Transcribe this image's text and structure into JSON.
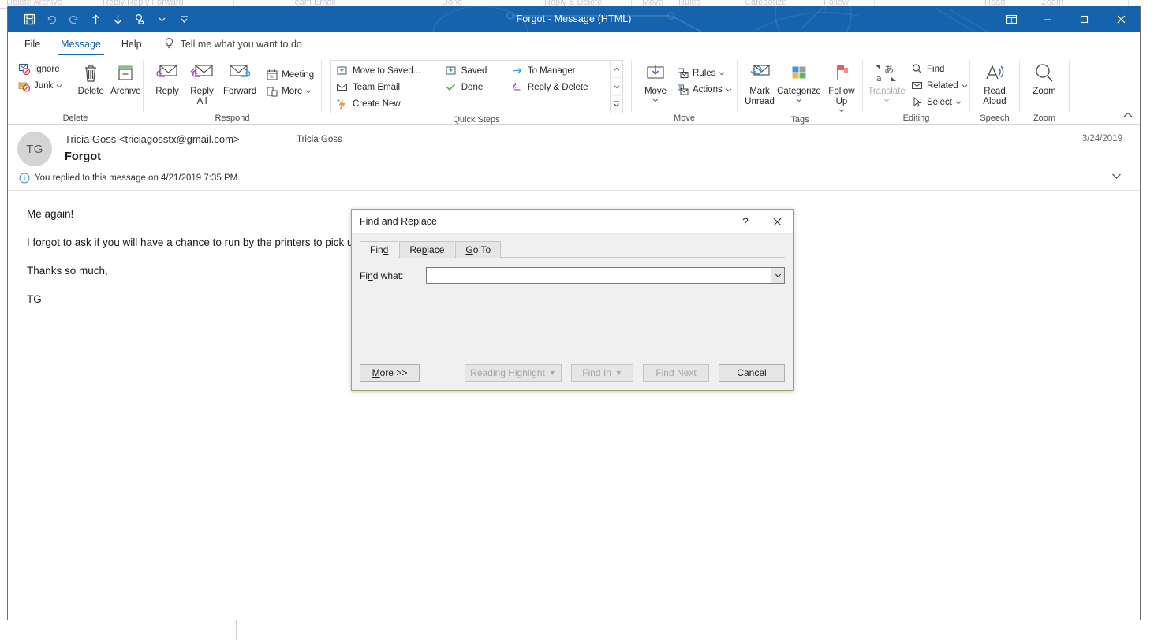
{
  "background": {
    "ghost_labels": [
      "Delete  Archive",
      "Reply  Reply  Forward",
      "Team Email",
      "Done",
      "Reply & Delete",
      "Move",
      "Rules",
      "Categorize",
      "Follow",
      "Read",
      "Zoom"
    ]
  },
  "window": {
    "title": "Forgot  -  Message (HTML)",
    "quick_access": [
      {
        "name": "save-icon",
        "label": "Save"
      },
      {
        "name": "undo-icon",
        "label": "Undo"
      },
      {
        "name": "redo-icon",
        "label": "Redo"
      },
      {
        "name": "previous-item-icon",
        "label": "Previous Item"
      },
      {
        "name": "next-item-icon",
        "label": "Next Item"
      },
      {
        "name": "touch-mode-icon",
        "label": "Touch/Mouse Mode"
      },
      {
        "name": "customize-qat-icon",
        "label": "Customize Quick Access Toolbar"
      }
    ],
    "controls": [
      {
        "name": "ribbon-display-options-icon",
        "label": "Ribbon Display Options"
      },
      {
        "name": "minimize-icon",
        "label": "Minimize"
      },
      {
        "name": "maximize-icon",
        "label": "Maximize"
      },
      {
        "name": "close-icon",
        "label": "Close"
      }
    ]
  },
  "tabs": [
    {
      "label": "File",
      "active": false
    },
    {
      "label": "Message",
      "active": true
    },
    {
      "label": "Help",
      "active": false
    }
  ],
  "tellme": {
    "label": "Tell me what you want to do",
    "icon": "lightbulb-icon"
  },
  "ribbon": {
    "groups": [
      {
        "label": "Delete",
        "small": [
          {
            "label": "Ignore",
            "icon": "ignore-icon"
          },
          {
            "label": "Junk",
            "icon": "junk-icon",
            "caret": true
          }
        ],
        "big": [
          {
            "label": "Delete",
            "icon": "trash-icon"
          },
          {
            "label": "Archive",
            "icon": "archive-icon"
          }
        ]
      },
      {
        "label": "Respond",
        "big": [
          {
            "label": "Reply",
            "icon": "reply-icon"
          },
          {
            "label": "Reply All",
            "icon": "reply-all-icon"
          },
          {
            "label": "Forward",
            "icon": "forward-icon"
          }
        ],
        "small": [
          {
            "label": "Meeting",
            "icon": "meeting-icon"
          },
          {
            "label": "More",
            "icon": "more-icon",
            "caret": true
          }
        ]
      },
      {
        "label": "Quick Steps",
        "gallery": [
          {
            "label": "Move to Saved...",
            "icon": "move-to-folder-icon"
          },
          {
            "label": "Saved",
            "icon": "move-to-folder-icon"
          },
          {
            "label": "To Manager",
            "icon": "forward-arrow-icon"
          },
          {
            "label": "Team Email",
            "icon": "envelope-icon"
          },
          {
            "label": "Done",
            "icon": "check-icon"
          },
          {
            "label": "Reply & Delete",
            "icon": "reply-delete-icon"
          },
          {
            "label": "Create New",
            "icon": "create-new-icon"
          }
        ],
        "has_launcher": true
      },
      {
        "label": "Move",
        "big": [
          {
            "label": "Move",
            "icon": "move-icon",
            "caret": true
          }
        ],
        "small": [
          {
            "label": "Rules",
            "icon": "rules-icon",
            "caret": true
          },
          {
            "label": "Actions",
            "icon": "actions-icon",
            "caret": true
          }
        ]
      },
      {
        "label": "Tags",
        "big": [
          {
            "label": "Mark Unread",
            "icon": "mark-unread-icon"
          },
          {
            "label": "Categorize",
            "icon": "categorize-icon",
            "caret": true
          },
          {
            "label": "Follow Up",
            "icon": "follow-up-flag-icon",
            "caret": true
          }
        ],
        "has_launcher": true
      },
      {
        "label": "Editing",
        "big": [
          {
            "label": "Translate",
            "icon": "translate-icon",
            "caret": true,
            "disabled": true
          }
        ],
        "small": [
          {
            "label": "Find",
            "icon": "find-magnifier-icon"
          },
          {
            "label": "Related",
            "icon": "related-icon",
            "caret": true
          },
          {
            "label": "Select",
            "icon": "select-pointer-icon",
            "caret": true
          }
        ]
      },
      {
        "label": "Speech",
        "big": [
          {
            "label": "Read Aloud",
            "icon": "read-aloud-icon"
          }
        ]
      },
      {
        "label": "Zoom",
        "big": [
          {
            "label": "Zoom",
            "icon": "zoom-magnifier-icon"
          }
        ]
      }
    ],
    "collapse_icon": "chevron-up-icon"
  },
  "message": {
    "avatar_initials": "TG",
    "from": "Tricia Goss <triciagosstx@gmail.com>",
    "to": "Tricia Goss",
    "subject": "Forgot",
    "date": "3/24/2019",
    "info_notice": "You replied to this message on 4/21/2019 7:35 PM.",
    "info_icon": "info-icon",
    "expander_icon": "chevron-down-icon",
    "body": [
      "Me again!",
      "I forgot to ask if you will have a chance to run by the printers to pick up",
      "Thanks so much,",
      "TG"
    ]
  },
  "dialog": {
    "title": "Find and Replace",
    "help_icon": "question-mark-icon",
    "close_icon": "close-icon",
    "tabs": [
      {
        "label": "Find",
        "active": true
      },
      {
        "label": "Replace",
        "active": false
      },
      {
        "label": "Go To",
        "active": false
      }
    ],
    "find_what_label": "Find what:",
    "find_what_value": "",
    "find_what_placeholder": "",
    "combo_caret_icon": "chevron-down-icon",
    "buttons": [
      {
        "label": "More >>",
        "disabled": false,
        "caret": false
      },
      {
        "label": "Reading Highlight",
        "disabled": true,
        "caret": true
      },
      {
        "label": "Find In",
        "disabled": true,
        "caret": true
      },
      {
        "label": "Find Next",
        "disabled": true,
        "caret": false
      },
      {
        "label": "Cancel",
        "disabled": false,
        "caret": false
      }
    ]
  },
  "colors": {
    "titlebar": "#1463ac",
    "accent": "#1463ac",
    "dialog_border": "#9aa36e",
    "category_blue": "#4a90d9",
    "category_gray": "#9e9e9e",
    "category_orange": "#f0b840",
    "category_green": "#5cb85c",
    "flag_red": "#ed5c5c",
    "purple_reply": "#a34fc0",
    "archive_green": "#8ec68e"
  }
}
